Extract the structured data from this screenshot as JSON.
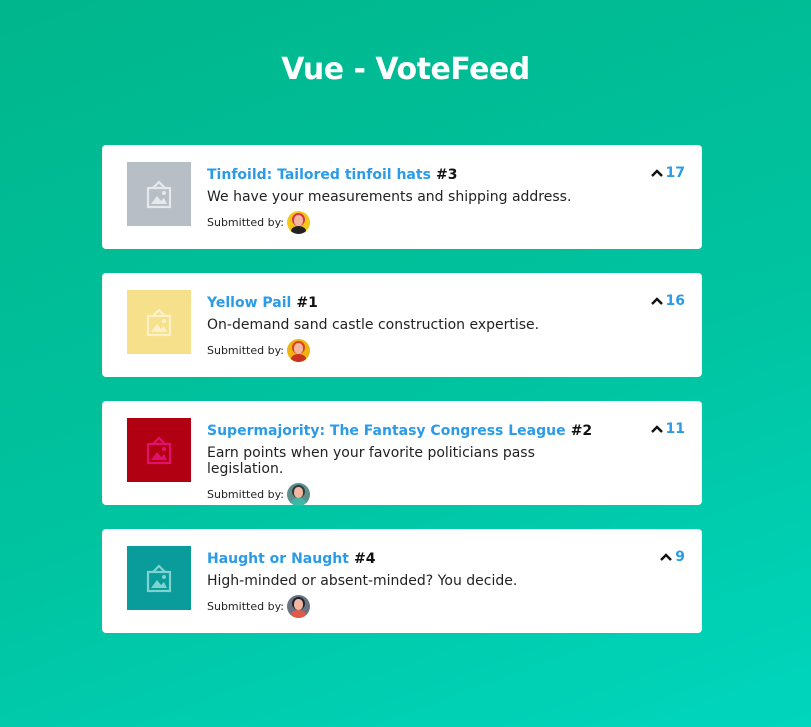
{
  "app_title": "Vue - VoteFeed",
  "submitted_label": "Submitted by:",
  "posts": [
    {
      "title": "Tinfoild: Tailored tinfoil hats",
      "rank": "#3",
      "description": "We have your measurements and shipping address.",
      "votes": "17",
      "thumb_color": "#b8bec6",
      "icon_color": "#e6e9ec",
      "avatar_bg": "#f2c816",
      "avatar_hair": "#d9324a",
      "avatar_body": "#222"
    },
    {
      "title": "Yellow Pail",
      "rank": "#1",
      "description": "On-demand sand castle construction expertise.",
      "votes": "16",
      "thumb_color": "#f7e08c",
      "icon_color": "#fcf1c8",
      "avatar_bg": "#f0b412",
      "avatar_hair": "#d9411c",
      "avatar_body": "#c8321e"
    },
    {
      "title": "Supermajority: The Fantasy Congress League",
      "rank": "#2",
      "description": "Earn points when your favorite politicians pass legislation.",
      "votes": "11",
      "thumb_color": "#b00012",
      "icon_color": "#e0106c",
      "avatar_bg": "#5f8f8a",
      "avatar_hair": "#2d3b3d",
      "avatar_body": "#3fb7a5"
    },
    {
      "title": "Haught or Naught",
      "rank": "#4",
      "description": "High-minded or absent-minded? You decide.",
      "votes": "9",
      "thumb_color": "#0a9b9b",
      "icon_color": "#7fd3d0",
      "avatar_bg": "#6b7280",
      "avatar_hair": "#1f2430",
      "avatar_body": "#e05a48"
    }
  ]
}
